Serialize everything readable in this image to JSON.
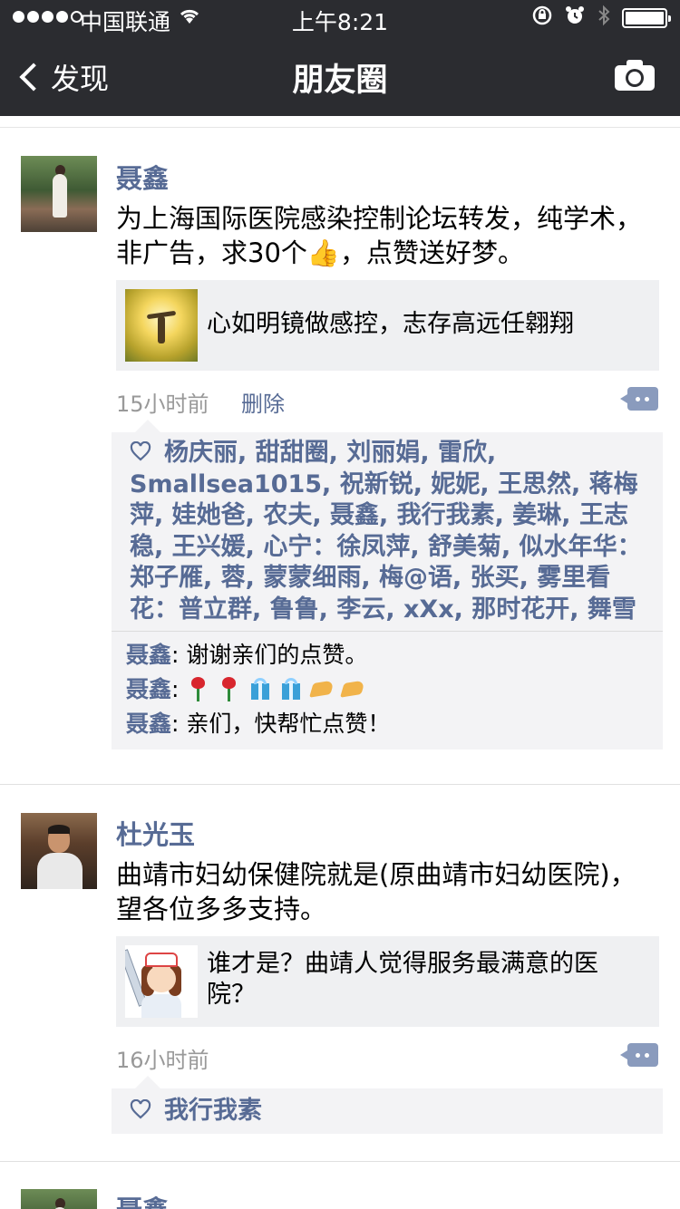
{
  "status_bar": {
    "carrier": "中国联通",
    "time": "上午8:21"
  },
  "nav": {
    "back_label": "发现",
    "title": "朋友圈"
  },
  "posts": [
    {
      "author": "聂鑫",
      "text_line1": "为上海国际医院感染控制论坛转发，纯学术，",
      "text_line2_a": "非广告，求30个",
      "text_line2_emoji": "👍",
      "text_line2_b": "，点赞送好梦。",
      "link_title": "心如明镜做感控，志存高远任翱翔",
      "time": "15小时前",
      "delete_label": "删除",
      "likes": "杨庆丽, 甜甜圈, 刘丽娟, 雷欣, Smallsea1015, 祝新锐, 妮妮, 王思然, 蒋梅萍, 娃她爸, 农夫, 聂鑫, 我行我素, 姜琳, 王志稳, 王兴媛, 心宁：徐凤萍, 舒美菊, 似水年华：郑子雁, 蓉, 蒙蒙细雨, 梅@语, 张买, 雾里看花：普立群, 鲁鲁, 李云, xXx, 那时花开, 舞雪",
      "comments": [
        {
          "name": "聂鑫",
          "sep": ": ",
          "text": "谢谢亲们的点赞。"
        },
        {
          "name": "聂鑫",
          "sep": ": ",
          "text": ""
        },
        {
          "name": "聂鑫",
          "sep": ": ",
          "text": "亲们，快帮忙点赞！"
        }
      ]
    },
    {
      "author": "杜光玉",
      "text_line1": "曲靖市妇幼保健院就是(原曲靖市妇幼医院)，",
      "text_line2": "望各位多多支持。",
      "link_title": "谁才是？曲靖人觉得服务最满意的医院？",
      "time": "16小时前",
      "likes": "我行我素"
    },
    {
      "author": "聂鑫"
    }
  ],
  "icons": {
    "back": "chevron-left-icon",
    "camera": "camera-icon",
    "heart": "heart-outline-icon",
    "comment": "comment-dots-icon"
  },
  "colors": {
    "nav_bg": "#2b2c30",
    "link_blue": "#576b95",
    "meta_gray": "#999999"
  }
}
